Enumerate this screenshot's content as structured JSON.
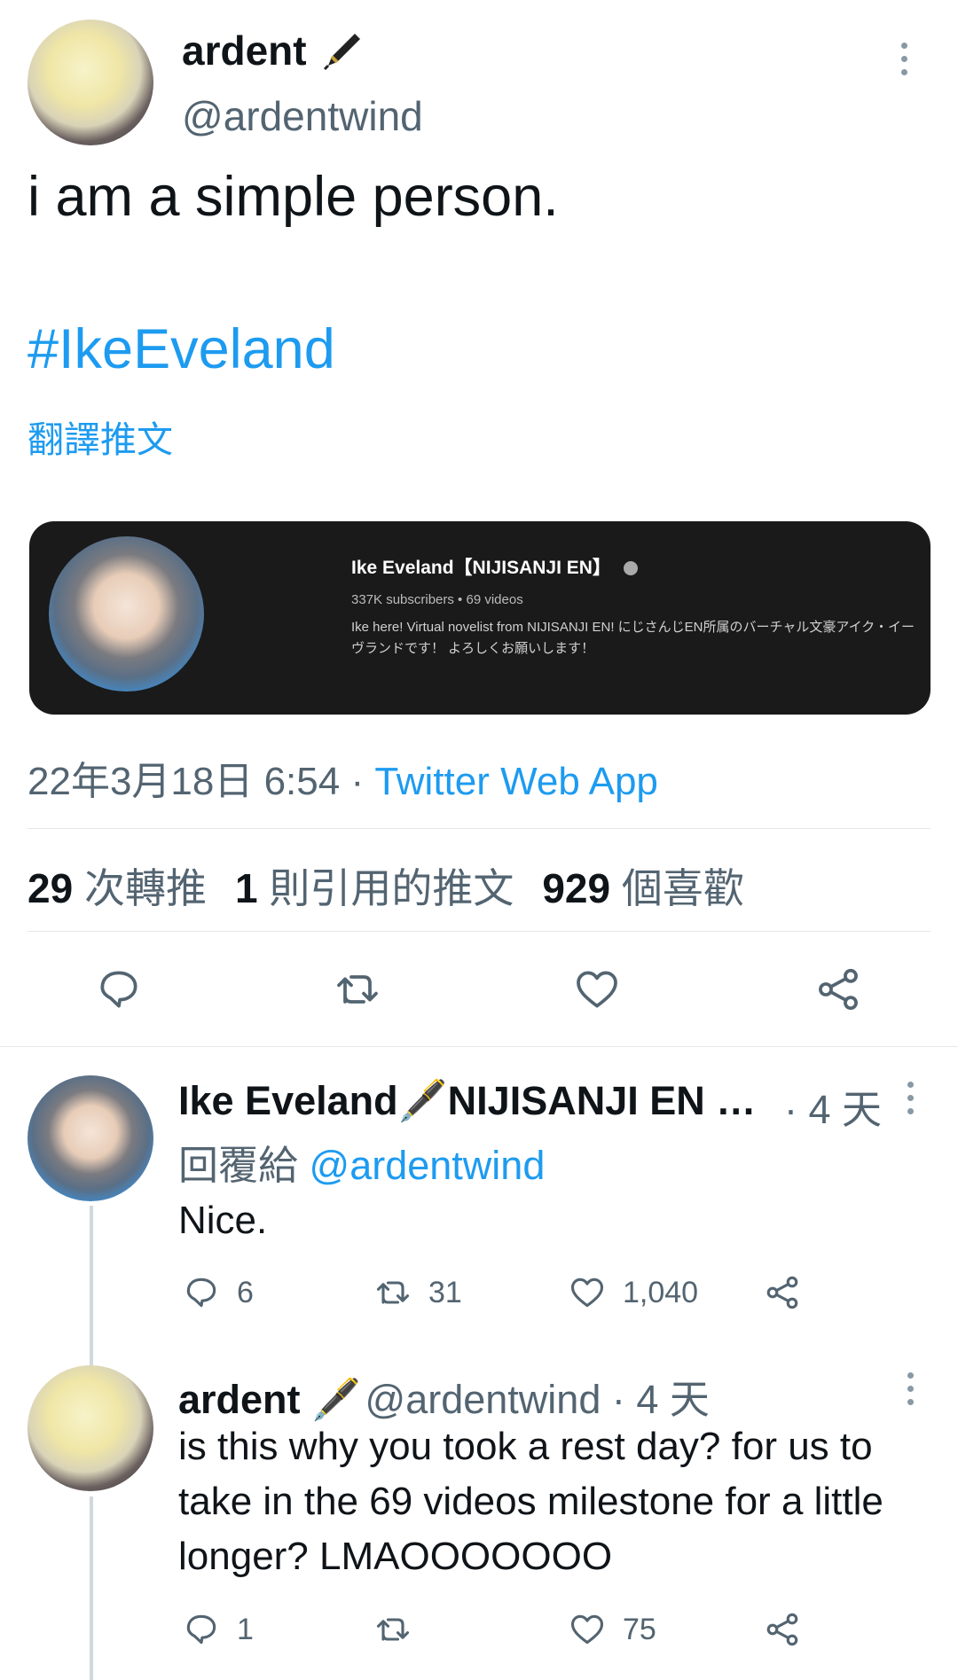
{
  "tweet": {
    "author_name": "ardent",
    "author_handle": "@ardentwind",
    "text": "i am a simple person.",
    "hashtag": "#IkeEveland",
    "translate_label": "翻譯推文",
    "card": {
      "channel_title": "Ike Eveland【NIJISANJI EN】",
      "subtitle": "337K subscribers • 69 videos",
      "description": "Ike here! Virtual novelist from NIJISANJI EN! にじさんじEN所属のバーチャル文豪アイク・イーヴランドです！ よろしくお願いします！"
    },
    "timestamp": "22年3月18日 6:54 · ",
    "client": "Twitter Web App",
    "stats": {
      "retweets": "29",
      "retweets_label": "次轉推",
      "quotes": "1",
      "quotes_label": "則引用的推文",
      "likes": "929",
      "likes_label": "個喜歡"
    }
  },
  "replies": [
    {
      "name": "Ike Eveland🖋️NIJISANJI EN …",
      "time": "· 4 天",
      "reply_to_label": "回覆給",
      "reply_to_handle": "@ardentwind",
      "text": "Nice.",
      "replies": "6",
      "retweets": "31",
      "likes": "1,040"
    },
    {
      "name": "ardent 🖋️",
      "handle_time": "@ardentwind · 4 天",
      "text": "is this why you took a rest day? for us to take in the 69 videos milestone for a little longer? LMAOOOOOOO",
      "replies": "1",
      "retweets": "",
      "likes": "75"
    }
  ],
  "icons": {
    "reply": "speech-bubble-icon",
    "retweet": "retweet-arrows-icon",
    "like": "heart-icon",
    "share": "share-nodes-icon",
    "more": "vertical-dots-icon",
    "pen": "fountain-pen-icon"
  }
}
